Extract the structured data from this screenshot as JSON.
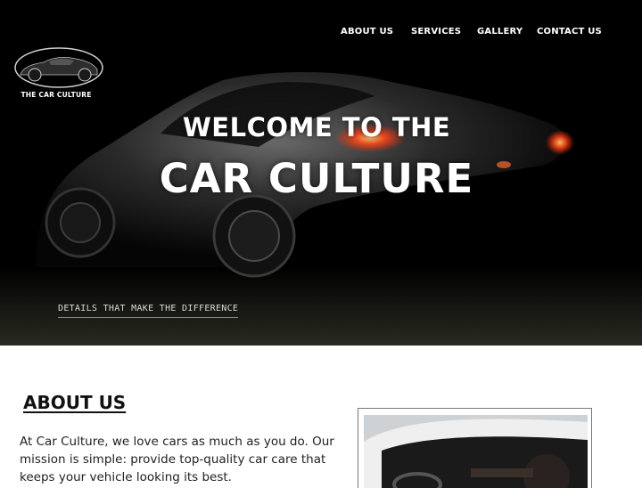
{
  "nav": {
    "items": [
      {
        "label": "ABOUT US"
      },
      {
        "label": "SERVICES"
      },
      {
        "label": "GALLERY"
      },
      {
        "label": "CONTACT US"
      }
    ]
  },
  "logo": {
    "label": "THE CAR CULTURE",
    "icon": "car-logo-icon"
  },
  "hero": {
    "line1": "WELCOME TO THE",
    "line2": "CAR CULTURE",
    "tagline": "DETAILS THAT MAKE THE DIFFERENCE"
  },
  "about": {
    "title": "ABOUT US",
    "text": "At Car Culture, we love cars as much as you do. Our mission is simple: provide top-quality car care that keeps your vehicle looking its best."
  },
  "colors": {
    "hero_bg": "#000000",
    "text_light": "#ffffff",
    "text_dark": "#111111",
    "tail_light": "#ff4a1a"
  }
}
